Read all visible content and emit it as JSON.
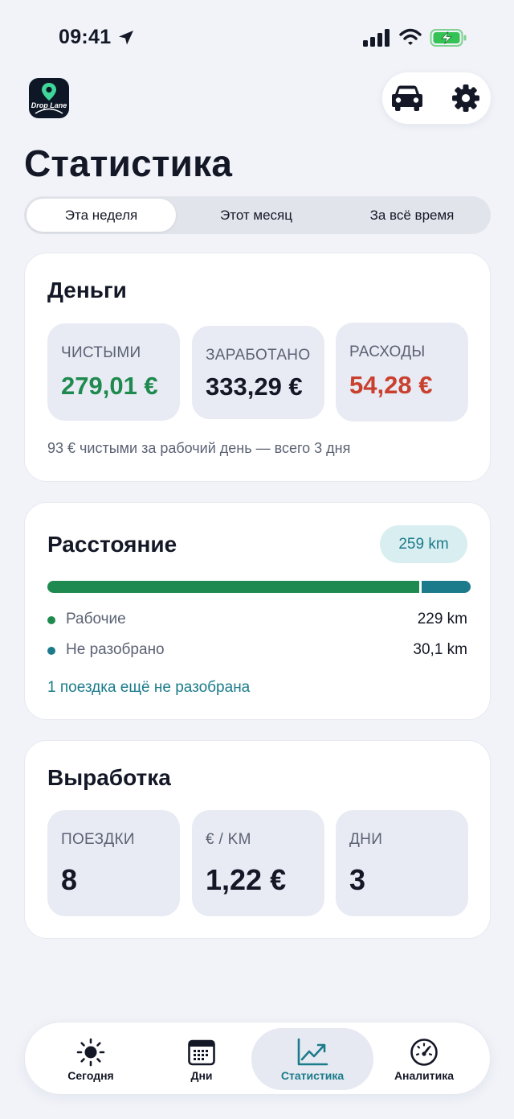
{
  "status_bar": {
    "time": "09:41"
  },
  "header": {
    "logo_text": "Drop Lane",
    "title": "Статистика"
  },
  "period_tabs": [
    {
      "label": "Эта неделя",
      "active": true
    },
    {
      "label": "Этот месяц",
      "active": false
    },
    {
      "label": "За всё время",
      "active": false
    }
  ],
  "money": {
    "title": "Деньги",
    "net": {
      "label": "ЧИСТЫМИ",
      "value": "279,01 €"
    },
    "earned": {
      "label": "ЗАРАБОТАНО",
      "value": "333,29 €"
    },
    "expenses": {
      "label": "РАСХОДЫ",
      "value": "54,28 €"
    },
    "note": "93 € чистыми за рабочий день — всего 3 дня"
  },
  "distance": {
    "title": "Расстояние",
    "total": "259 km",
    "work": {
      "label": "Рабочие",
      "value": "229 km",
      "km": 229
    },
    "unsorted": {
      "label": "Не разобрано",
      "value": "30,1 km",
      "km": 30.1
    },
    "link": "1 поездка ещё не разобрана"
  },
  "output": {
    "title": "Выработка",
    "trips": {
      "label": "ПОЕЗДКИ",
      "value": "8"
    },
    "per_km": {
      "label": "€ / KM",
      "value": "1,22 €"
    },
    "days": {
      "label": "ДНИ",
      "value": "3"
    }
  },
  "tabbar": [
    {
      "label": "Сегодня",
      "icon": "sun-icon"
    },
    {
      "label": "Дни",
      "icon": "calendar-icon"
    },
    {
      "label": "Статистика",
      "icon": "chart-trend-icon",
      "active": true
    },
    {
      "label": "Аналитика",
      "icon": "speedometer-icon"
    }
  ],
  "colors": {
    "accent": "#1b7b8a",
    "positive": "#1f8a4f",
    "negative": "#c9402f",
    "background": "#f1f3f9"
  }
}
